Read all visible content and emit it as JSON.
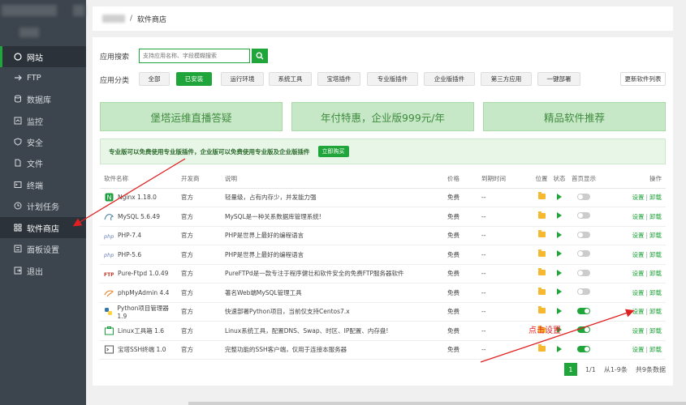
{
  "sidebar": {
    "items": [
      {
        "label": "网站",
        "icon": "globe-icon"
      },
      {
        "label": "FTP",
        "icon": "ftp-icon"
      },
      {
        "label": "数据库",
        "icon": "database-icon"
      },
      {
        "label": "监控",
        "icon": "monitor-icon"
      },
      {
        "label": "安全",
        "icon": "shield-icon"
      },
      {
        "label": "文件",
        "icon": "file-icon"
      },
      {
        "label": "终端",
        "icon": "terminal-icon"
      },
      {
        "label": "计划任务",
        "icon": "clock-icon"
      },
      {
        "label": "软件商店",
        "icon": "grid-icon"
      },
      {
        "label": "面板设置",
        "icon": "settings-icon"
      },
      {
        "label": "退出",
        "icon": "logout-icon"
      }
    ]
  },
  "header": {
    "breadcrumb_sep": "/",
    "title": "软件商店"
  },
  "search": {
    "label": "应用搜索",
    "placeholder": "支持应用名称、字段模糊搜索"
  },
  "categories": {
    "label": "应用分类",
    "items": [
      "全部",
      "已安装",
      "运行环境",
      "系统工具",
      "宝塔插件",
      "专业版插件",
      "企业版插件",
      "第三方应用",
      "一键部署"
    ],
    "selected": "已安装",
    "update_label": "更新软件列表"
  },
  "banners": [
    "堡塔运维直播答疑",
    "年付特惠，企业版999元/年",
    "精品软件推荐"
  ],
  "notice": {
    "text": "专业版可以免费使用专业版插件，企业版可以免费使用专业版及企业版插件",
    "button": "立即购买"
  },
  "table": {
    "headers": [
      "软件名称",
      "开发商",
      "说明",
      "价格",
      "到期时间",
      "位置",
      "状态",
      "首页显示",
      "操作"
    ],
    "rows": [
      {
        "name": "Nginx 1.18.0",
        "vendor": "官方",
        "desc": "轻量级，占有内存少，并发能力强",
        "price": "免费",
        "expire": "--",
        "home": false
      },
      {
        "name": "MySQL 5.6.49",
        "vendor": "官方",
        "desc": "MySQL是一种关系数据库管理系统!",
        "price": "免费",
        "expire": "--",
        "home": false
      },
      {
        "name": "PHP-7.4",
        "vendor": "官方",
        "desc": "PHP是世界上最好的编程语言",
        "price": "免费",
        "expire": "--",
        "home": false
      },
      {
        "name": "PHP-5.6",
        "vendor": "官方",
        "desc": "PHP是世界上最好的编程语言",
        "price": "免费",
        "expire": "--",
        "home": false
      },
      {
        "name": "Pure-Ftpd 1.0.49",
        "vendor": "官方",
        "desc": "PureFTPd是一款专注于程序健壮和软件安全的免费FTP服务器软件",
        "price": "免费",
        "expire": "--",
        "home": false
      },
      {
        "name": "phpMyAdmin 4.4",
        "vendor": "官方",
        "desc": "著名Web端MySQL管理工具",
        "price": "免费",
        "expire": "--",
        "home": false
      },
      {
        "name": "Python项目管理器 1.9",
        "vendor": "官方",
        "desc": "快速部署Python项目，当前仅支持Centos7.x",
        "price": "免费",
        "expire": "--",
        "home": true
      },
      {
        "name": "Linux工具箱 1.6",
        "vendor": "官方",
        "desc": "Linux系统工具，配置DNS、Swap、时区、IP配置、内存盘!",
        "price": "免费",
        "expire": "--",
        "home": true
      },
      {
        "name": "宝塔SSH终端 1.0",
        "vendor": "官方",
        "desc": "完整功能的SSH客户端，仅用于连接本服务器",
        "price": "免费",
        "expire": "--",
        "home": true
      }
    ],
    "action_setting": "设置",
    "action_sep": "|",
    "action_uninstall": "卸载"
  },
  "pager": {
    "current": "1",
    "page_info": "1/1",
    "range": "从1-9条",
    "total": "共9条数据"
  },
  "annotation": {
    "label": "点击设置"
  },
  "colors": {
    "accent": "#20a53a",
    "sidebar": "#3c444d",
    "annotation": "#e02020"
  }
}
